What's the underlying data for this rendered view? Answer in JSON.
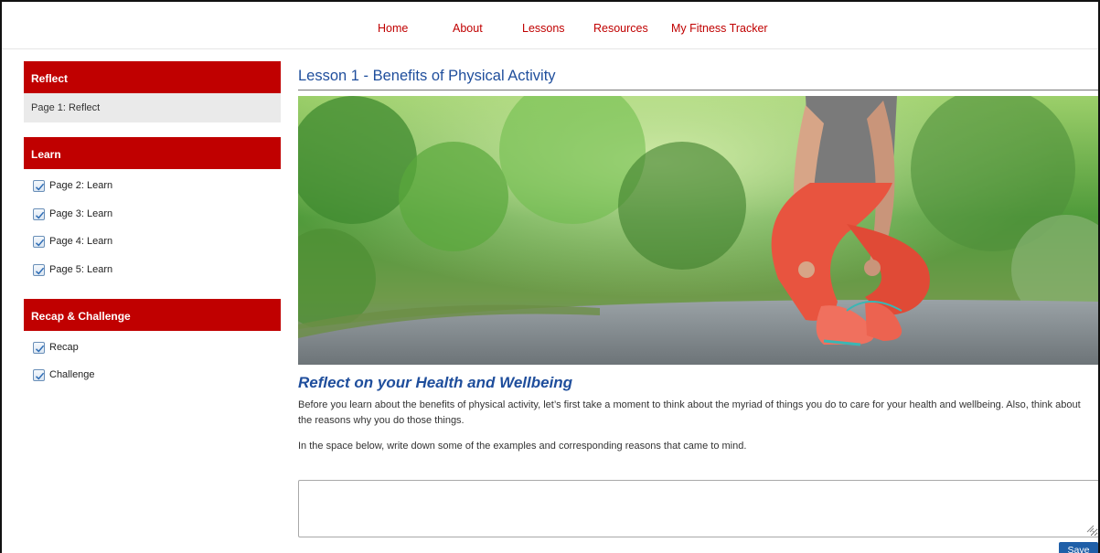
{
  "nav": {
    "items": [
      {
        "label": "Home"
      },
      {
        "label": "About"
      },
      {
        "label": "Lessons"
      },
      {
        "label": "Resources"
      },
      {
        "label": "My Fitness Tracker"
      }
    ]
  },
  "sidebar": {
    "sections": [
      {
        "title": "Reflect",
        "items": [
          {
            "label": "Page 1: Reflect",
            "current": true
          }
        ]
      },
      {
        "title": "Learn",
        "items": [
          {
            "label": "Page 2: Learn",
            "checked": true
          },
          {
            "label": "Page 3: Learn",
            "checked": true
          },
          {
            "label": "Page 4: Learn",
            "checked": true
          },
          {
            "label": "Page 5: Learn",
            "checked": true
          }
        ]
      },
      {
        "title": "Recap & Challenge",
        "items": [
          {
            "label": "Recap",
            "checked": true
          },
          {
            "label": "Challenge",
            "checked": true
          }
        ]
      }
    ]
  },
  "main": {
    "lesson_title": "Lesson 1 - Benefits of Physical Activity",
    "section_heading": "Reflect on your Health and Wellbeing",
    "paragraph1": "Before you learn about the benefits of physical activity, let’s first take a moment to think about the myriad of things you do to care for your health and wellbeing. Also, think about the reasons why you do those things.",
    "paragraph2": "In the space below, write down some of the examples and corresponding reasons that came to mind.",
    "answer_value": "",
    "save_label": "Save"
  },
  "colors": {
    "brand_red": "#c00000",
    "heading_blue": "#1f4e9c",
    "button_blue": "#1f5fa8"
  }
}
